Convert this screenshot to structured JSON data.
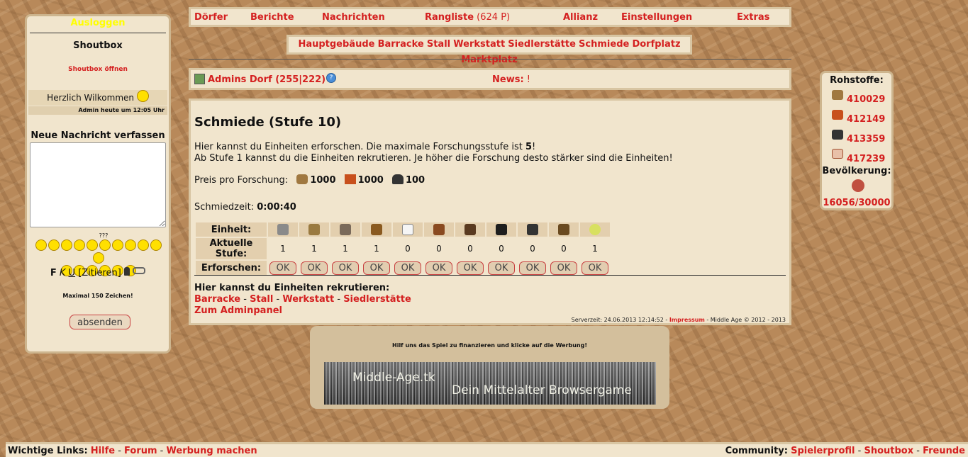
{
  "sidebar": {
    "logout": "Ausloggen",
    "shoutbox_title": "Shoutbox",
    "shoutbox_open": "Shoutbox öffnen",
    "welcome": "Herzlich Wilkommen",
    "welcome_time": "Admin heute um 12:05 Uhr",
    "new_message_title": "Neue Nachricht verfassen",
    "smiley_extra": "???",
    "format_bold": "F",
    "format_italic": "K",
    "format_underline": "U",
    "format_quote": "[Zitieren]",
    "max_chars": "Maximal 150 Zeichen!",
    "send_label": "absenden"
  },
  "topnav": {
    "villages": "Dörfer",
    "reports": "Berichte",
    "messages": "Nachrichten",
    "ranking": "Rangliste",
    "ranking_points": "(624 P)",
    "alliance": "Allianz",
    "settings": "Einstellungen",
    "extras": "Extras"
  },
  "buildings": [
    "Hauptgebäude",
    "Barracke",
    "Stall",
    "Werkstatt",
    "Siedlerstätte",
    "Schmiede",
    "Dorfplatz",
    "Marktplatz"
  ],
  "village": {
    "name": "Admins Dorf (255|222)",
    "news_label": "News:",
    "news_text": "!"
  },
  "main": {
    "title": "Schmiede (Stufe 10)",
    "line1_a": "Hier kannst du Einheiten erforschen. Die maximale Forschungsstufe ist ",
    "line1_max": "5",
    "line1_b": "!",
    "line2": "Ab Stufe 1 kannst du die Einheiten rekrutieren. Je höher die Forschung desto stärker sind die Einheiten!",
    "price_label": "Preis pro Forschung:",
    "price_wood": "1000",
    "price_clay": "1000",
    "price_iron": "100",
    "time_label": "Schmiedzeit:",
    "time_value": "0:00:40",
    "row_unit": "Einheit:",
    "row_level": "Aktuelle Stufe:",
    "row_research": "Erforschen:",
    "ok_label": "OK",
    "recruit_title": "Hier kannst du Einheiten rekrutieren:",
    "recruit_links": [
      "Barracke",
      "Stall",
      "Werkstatt",
      "Siedlerstätte"
    ],
    "admin_link": "Zum Adminpanel",
    "server_time": "Serverzeit: 24.06.2013 12:14:52 - ",
    "impressum": "Impressum",
    "copyright": " - Middle Age © 2012 - 2013"
  },
  "units": [
    {
      "icon": "spear-icon",
      "color": "#8a8a8a",
      "level": "1"
    },
    {
      "icon": "sword-icon",
      "color": "#9a7a40",
      "level": "1"
    },
    {
      "icon": "axe-icon",
      "color": "#7a6a5a",
      "level": "1"
    },
    {
      "icon": "bow-icon",
      "color": "#8a5a20",
      "level": "1"
    },
    {
      "icon": "white-horse-icon",
      "color": "#f5f5f5",
      "level": "0"
    },
    {
      "icon": "brown-horse-icon",
      "color": "#8a4a20",
      "level": "0"
    },
    {
      "icon": "dark-horse-icon",
      "color": "#5a3a20",
      "level": "0"
    },
    {
      "icon": "black-horse-icon",
      "color": "#1e1e1e",
      "level": "0"
    },
    {
      "icon": "ram-icon",
      "color": "#333333",
      "level": "0"
    },
    {
      "icon": "catapult-icon",
      "color": "#6a4a20",
      "level": "0"
    },
    {
      "icon": "settler-icon",
      "color": "#d8e060",
      "level": "1"
    }
  ],
  "ad": {
    "text": "Hilf uns das Spiel zu finanzieren und klicke auf die Werbung!",
    "banner_line1": "Middle-Age.tk",
    "banner_line2": "Dein Mittelalter Browsergame"
  },
  "resources": {
    "title": "Rohstoffe:",
    "wood": "410029",
    "clay": "412149",
    "iron": "413359",
    "food": "417239",
    "population_title": "Bevölkerung:",
    "population": "16056/30000"
  },
  "footer": {
    "important_label": "Wichtige Links:",
    "help": "Hilfe",
    "forum": "Forum",
    "ads": "Werbung machen",
    "community_label": "Community:",
    "profile": "Spielerprofil",
    "shoutbox": "Shoutbox",
    "friends": "Freunde"
  },
  "colors": {
    "link": "#d42020",
    "panel": "#f1e5cd",
    "border": "#d8c5a2",
    "logout": "#ffff00"
  }
}
